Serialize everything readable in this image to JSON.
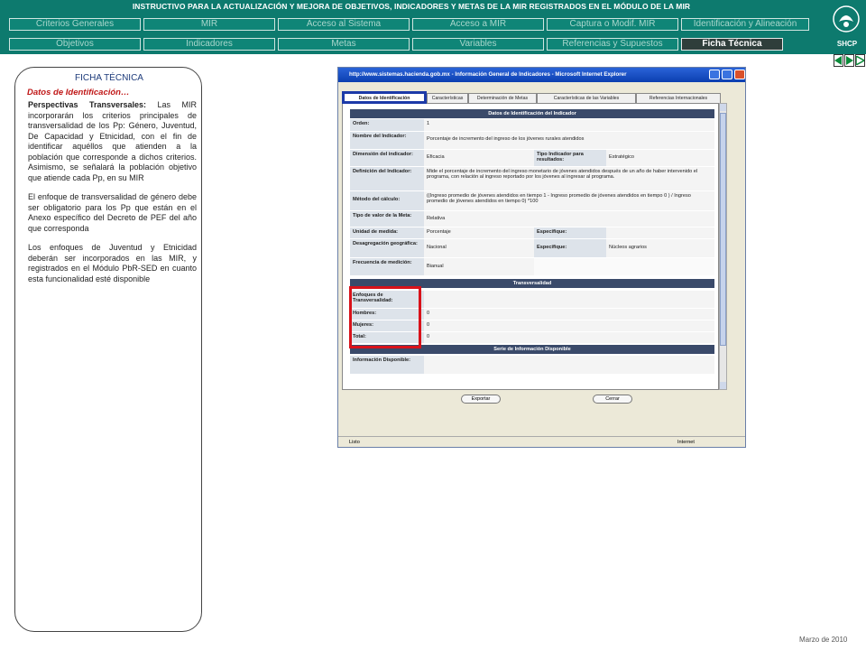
{
  "header": {
    "title": "INSTRUCTIVO PARA LA ACTUALIZACIÓN Y MEJORA DE OBJETIVOS, INDICADORES Y METAS DE LA MIR REGISTRADOS EN EL MÓDULO DE LA MIR",
    "logo_label": "SHCP"
  },
  "nav_row1": [
    "Criterios Generales",
    "MIR",
    "Acceso al Sistema",
    "Acceso a MIR",
    "Captura o Modif. MIR",
    "Identificación y Alineación"
  ],
  "nav_row2": [
    "Objetivos",
    "Indicadores",
    "Metas",
    "Variables",
    "Referencias y Supuestos",
    "Ficha Técnica"
  ],
  "panel": {
    "title": "FICHA TÉCNICA",
    "subtitle": "Datos de Identificación…",
    "p1_bold": "Perspectivas Transversales:",
    "p1_rest": " Las MIR incorporarán los criterios principales de transversalidad de los Pp: Género, Juventud, De Capacidad y Etnicidad, con el fin de identificar aquéllos que atienden a la población que corresponde a dichos criterios. Asimismo, se señalará la población objetivo que atiende cada Pp, en su MIR",
    "p2": "El enfoque de transversalidad de género debe ser obligatorio para los Pp que están en el Anexo específico del Decreto de PEF del año que corresponda",
    "p3": "Los enfoques de Juventud y Etnicidad deberán ser incorporados en las MIR, y registrados en el Módulo PbR-SED en cuanto esta funcionalidad esté disponible"
  },
  "footer": "Marzo de 2010",
  "ie": {
    "title": "http://www.sistemas.hacienda.gob.mx - Información General de Indicadores - Microsoft Internet Explorer",
    "tabs": [
      "Datos de Identificación",
      "Características",
      "Determinación de Metas",
      "Características de las Variables",
      "Referencias Internacionales"
    ],
    "section1": "Datos de Identificación del Indicador",
    "rows": [
      {
        "label": "Orden:",
        "value": "1"
      },
      {
        "label": "Nombre del Indicador:",
        "value": "Porcentaje de incremento del ingreso de los jóvenes rurales atendidos"
      },
      {
        "label": "Dimensión del indicador:",
        "value": "Eficacia",
        "label2": "Tipo Indicador para resultados:",
        "value2": "Estratégico"
      },
      {
        "label": "Definición del Indicador:",
        "value": "Mide el porcentaje de incremento del ingreso monetario de jóvenes atendidos después de un año de haber intervenido el programa, con relación al ingreso reportado por los jóvenes al ingresar al programa."
      },
      {
        "label": "Método del cálculo:",
        "value": "((Ingreso promedio de jóvenes atendidos en tiempo 1 - Ingreso promedio de jóvenes atendidos en tiempo 0 ) / Ingreso promedio de jóvenes atendidos en tiempo 0) *100"
      },
      {
        "label": "Tipo de valor de la Meta:",
        "value": "Relativa"
      },
      {
        "label": "Unidad de medida:",
        "value": "Porcentaje",
        "label2": "Especifique:",
        "value2": ""
      },
      {
        "label": "Desagregación geográfica:",
        "value": "Nacional",
        "label2": "Especifique:",
        "value2": "Núcleos agrarios"
      },
      {
        "label": "Frecuencia de medición:",
        "value": "Bianual"
      }
    ],
    "section2": "Transversalidad",
    "trans_rows": [
      {
        "label": "Enfoques de Transversalidad:",
        "value": ""
      },
      {
        "label": "Hombres:",
        "value": "0"
      },
      {
        "label": "Mujeres:",
        "value": "0"
      },
      {
        "label": "Total:",
        "value": "0"
      }
    ],
    "section3": "Serie de Información Disponible",
    "info_row": {
      "label": "Información Disponible:",
      "value": ""
    },
    "btn_export": "Exportar",
    "btn_close": "Cerrar",
    "status": "Listo",
    "zone": "Internet"
  },
  "colors": {
    "header_bg": "#0d7a6e",
    "highlight_red": "#d8121a",
    "highlight_blue": "#1c3aa8"
  }
}
